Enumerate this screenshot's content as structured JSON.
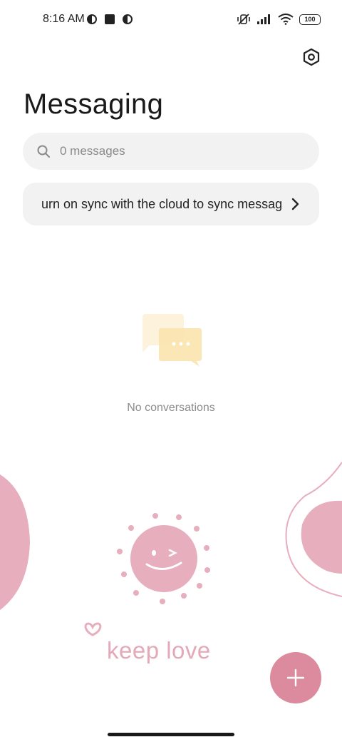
{
  "status_bar": {
    "time": "8:16 AM",
    "battery": "100",
    "icons": [
      "vpn-icon",
      "square-app-icon",
      "vpn-icon",
      "mute-vibrate-icon",
      "signal-icon",
      "wifi-icon",
      "battery-icon"
    ]
  },
  "header": {
    "title": "Messaging",
    "settings_icon": "gear-hexagon-icon"
  },
  "search": {
    "placeholder": "0 messages"
  },
  "sync_banner": {
    "text": "urn on sync with the cloud to sync messag"
  },
  "empty_state": {
    "text": "No conversations",
    "icon": "chat-bubbles-icon"
  },
  "decoration": {
    "caption": "keep love",
    "accent": "#e4a9b8"
  },
  "fab": {
    "icon": "plus-icon",
    "color": "#dc8a9d"
  }
}
